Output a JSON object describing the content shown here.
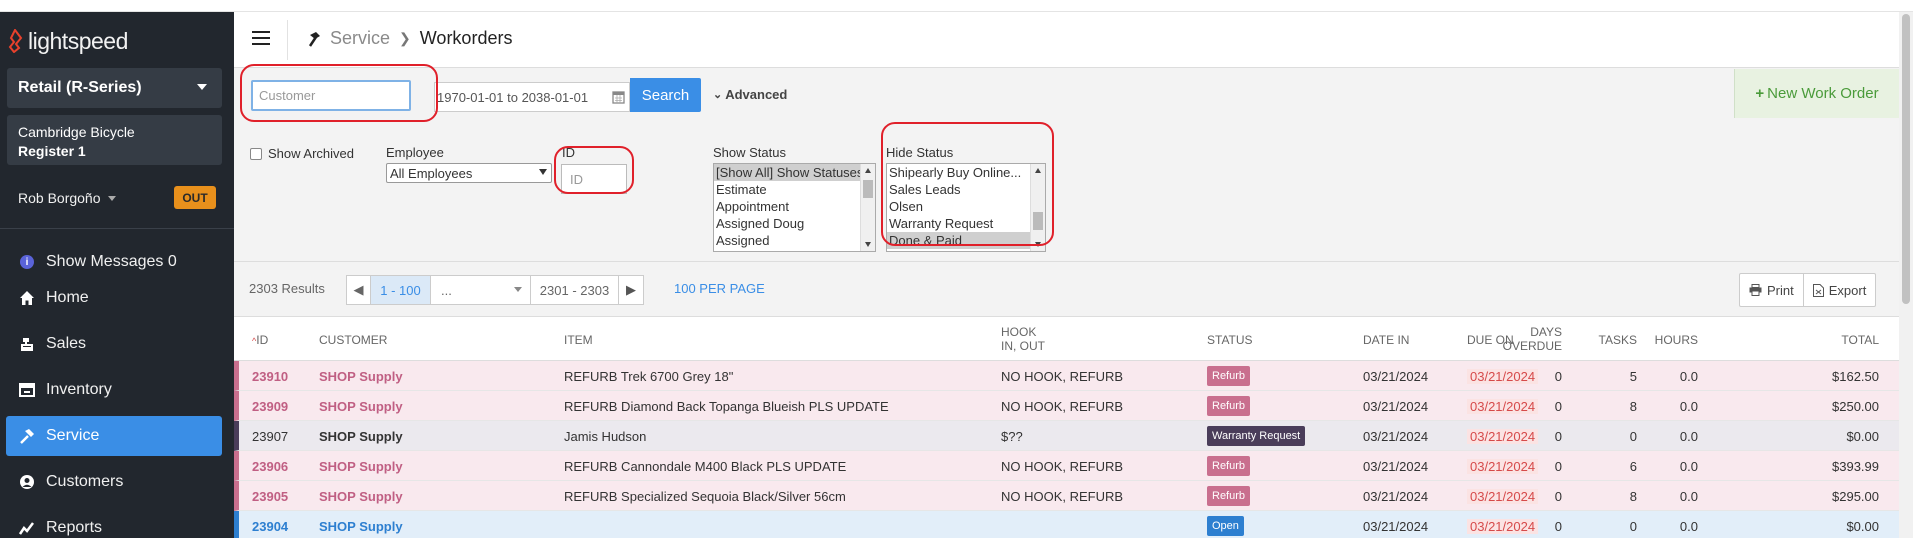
{
  "brand": {
    "name": "lightspeed"
  },
  "sidebar": {
    "store": "Retail (R-Series)",
    "location": "Cambridge Bicycle",
    "register": "Register 1",
    "user": "Rob Borgoño",
    "out_label": "OUT",
    "messages": {
      "label": "Show Messages",
      "count": "0"
    },
    "items": [
      {
        "label": "Home",
        "icon": "home-icon"
      },
      {
        "label": "Sales",
        "icon": "cash-register-icon"
      },
      {
        "label": "Inventory",
        "icon": "inventory-icon"
      },
      {
        "label": "Service",
        "icon": "hammer-icon",
        "active": true
      },
      {
        "label": "Customers",
        "icon": "user-icon"
      },
      {
        "label": "Reports",
        "icon": "chart-icon"
      }
    ]
  },
  "header": {
    "section": "Service",
    "page": "Workorders"
  },
  "filters": {
    "customer_placeholder": "Customer",
    "date_range": "1970-01-01 to 2038-01-01",
    "search_label": "Search",
    "advanced_label": "Advanced",
    "new_wo_label": "New Work Order",
    "show_archived": "Show Archived",
    "employee_label": "Employee",
    "employee_value": "All Employees",
    "id_label": "ID",
    "id_placeholder": "ID",
    "show_status_label": "Show Status",
    "show_status_options": [
      "[Show All] Show Statuses",
      "Estimate",
      "Appointment",
      "Assigned Doug",
      "Assigned"
    ],
    "hide_status_label": "Hide Status",
    "hide_status_options": [
      "Shipearly Buy Online...",
      "Sales Leads",
      "Olsen",
      "Warranty Request",
      "Done & Paid"
    ]
  },
  "results": {
    "count": "2303 Results",
    "current_page": "1 - 100",
    "ellipsis": "...",
    "last_page": "2301 - 2303",
    "per_page": "100 PER PAGE",
    "print": "Print",
    "export": "Export"
  },
  "table": {
    "columns": {
      "id": "ID",
      "customer": "CUSTOMER",
      "item": "ITEM",
      "hook1": "HOOK",
      "hook2": "IN, OUT",
      "status": "STATUS",
      "date_in": "DATE IN",
      "due_on": "DUE ON",
      "days1": "DAYS",
      "days2": "OVERDUE",
      "tasks": "TASKS",
      "hours": "HOURS",
      "total": "TOTAL"
    },
    "rows": [
      {
        "id": "23910",
        "customer": "SHOP Supply",
        "item": "REFURB Trek 6700 Grey 18\"",
        "hook": "NO HOOK, REFURB",
        "status": "Refurb",
        "date_in": "03/21/2024",
        "due_on": "03/21/2024",
        "days": "0",
        "tasks": "5",
        "hours": "0.0",
        "total": "$162.50"
      },
      {
        "id": "23909",
        "customer": "SHOP Supply",
        "item": "REFURB Diamond Back Topanga Blueish PLS UPDATE",
        "hook": "NO HOOK, REFURB",
        "status": "Refurb",
        "date_in": "03/21/2024",
        "due_on": "03/21/2024",
        "days": "0",
        "tasks": "8",
        "hours": "0.0",
        "total": "$250.00"
      },
      {
        "id": "23907",
        "customer": "SHOP Supply",
        "item": "Jamis Hudson",
        "hook": "$??",
        "status": "Warranty Request",
        "date_in": "03/21/2024",
        "due_on": "03/21/2024",
        "days": "0",
        "tasks": "0",
        "hours": "0.0",
        "total": "$0.00"
      },
      {
        "id": "23906",
        "customer": "SHOP Supply",
        "item": "REFURB Cannondale M400 Black PLS UPDATE",
        "hook": "NO HOOK, REFURB",
        "status": "Refurb",
        "date_in": "03/21/2024",
        "due_on": "03/21/2024",
        "days": "0",
        "tasks": "6",
        "hours": "0.0",
        "total": "$393.99"
      },
      {
        "id": "23905",
        "customer": "SHOP Supply",
        "item": "REFURB Specialized Sequoia Black/Silver 56cm",
        "hook": "NO HOOK, REFURB",
        "status": "Refurb",
        "date_in": "03/21/2024",
        "due_on": "03/21/2024",
        "days": "0",
        "tasks": "8",
        "hours": "0.0",
        "total": "$295.00"
      },
      {
        "id": "23904",
        "customer": "SHOP Supply",
        "item": "",
        "hook": "",
        "status": "Open",
        "date_in": "03/21/2024",
        "due_on": "03/21/2024",
        "days": "0",
        "tasks": "0",
        "hours": "0.0",
        "total": "$0.00"
      }
    ]
  },
  "colors": {
    "accent": "#3a8ee6",
    "sidebar": "#22272e",
    "refurb": "#c96f8e",
    "warranty": "#4a3d5a",
    "open": "#2d7fd0",
    "out": "#e8901c",
    "annotation": "#e0202a"
  }
}
